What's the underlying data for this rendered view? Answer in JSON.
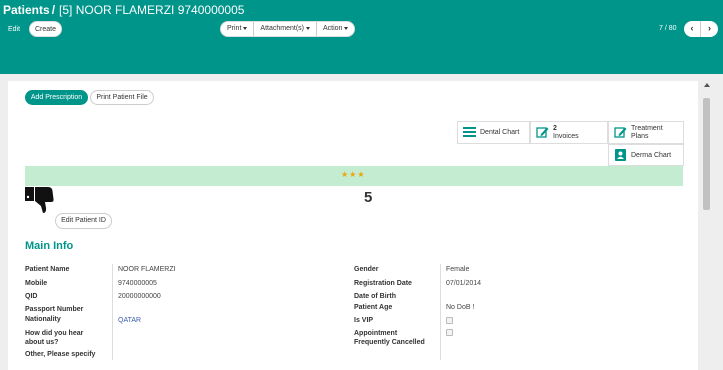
{
  "header": {
    "root": "Patients",
    "separator": "/",
    "record": "[5] NOOR FLAMERZI 9740000005",
    "edit_label": "Edit",
    "create_label": "Create",
    "dropdowns": [
      {
        "label": "Print"
      },
      {
        "label": "Attachment(s)"
      },
      {
        "label": "Action"
      }
    ],
    "pager": "7 / 80",
    "prev_icon": "chevron-left-icon",
    "next_icon": "chevron-right-icon"
  },
  "actions": {
    "add_prescription": "Add Prescription",
    "print_patient_file": "Print Patient File"
  },
  "smart_buttons": {
    "dental_chart": "Dental Chart",
    "invoices_count": "2",
    "invoices_label": "Invoices",
    "treatment_line1": "Treatment",
    "treatment_line2": "Plans",
    "derma_chart": "Derma Chart"
  },
  "rating": {
    "stars": "★★★",
    "score": "5",
    "thumb_icon": "thumbs-down-icon",
    "edit_patient_id": "Edit Patient ID"
  },
  "main_info": {
    "title": "Main Info",
    "left": {
      "patient_name_label": "Patient Name",
      "patient_name": "NOOR FLAMERZI",
      "mobile_label": "Mobile",
      "mobile": "9740000005",
      "qid_label": "QID",
      "qid": "20000000000",
      "passport_label": "Passport Number",
      "nationality_label": "Nationality",
      "nationality": "QATAR",
      "hear_label_1": "How did you hear",
      "hear_label_2": "about us?",
      "other_label": "Other, Please specify"
    },
    "right": {
      "gender_label": "Gender",
      "gender": "Female",
      "reg_date_label": "Registration Date",
      "reg_date": "07/01/2014",
      "dob_label": "Date of Birth",
      "age_label": "Patient Age",
      "age": "No DoB !",
      "vip_label": "Is VIP",
      "appt_label_1": "Appointment",
      "appt_label_2": "Frequently Cancelled"
    }
  },
  "colors": {
    "brand": "#00958a",
    "rating_bar": "#c3ecd1",
    "star": "#f0a30a",
    "link": "#3a5fad"
  }
}
